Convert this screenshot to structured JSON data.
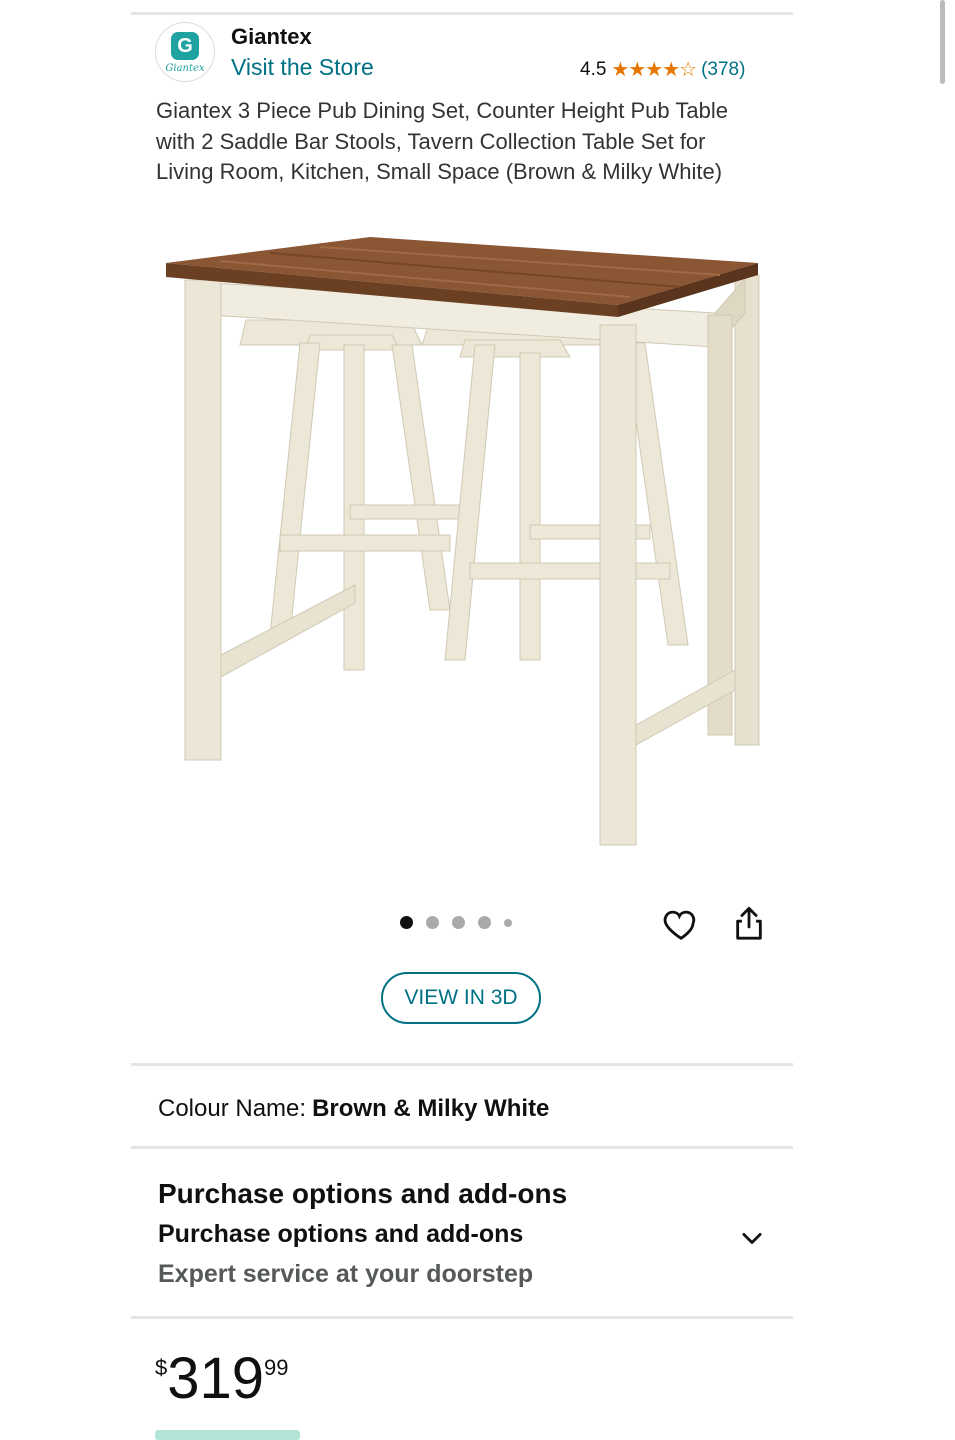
{
  "seller": {
    "logo_letter": "G",
    "logo_word": "Giantex",
    "brand": "Giantex",
    "store_link": "Visit the Store",
    "rating": "4.5",
    "stars": "★★★★☆",
    "review_count": "(378)"
  },
  "product": {
    "title": "Giantex 3 Piece Pub Dining Set, Counter Height Pub Table with 2 Saddle Bar Stools, Tavern Collection Table Set for Living Room, Kitchen, Small Space (Brown & Milky White)",
    "image_alt": "Counter height pub table with two saddle bar stools"
  },
  "gallery": {
    "dots": [
      {
        "active": true,
        "size": "normal"
      },
      {
        "active": false,
        "size": "normal"
      },
      {
        "active": false,
        "size": "normal"
      },
      {
        "active": false,
        "size": "normal"
      },
      {
        "active": false,
        "size": "small"
      }
    ],
    "icons": {
      "wishlist": "heart-icon",
      "share": "share-icon"
    },
    "view3d_label": "VIEW IN 3D"
  },
  "colour": {
    "label": "Colour Name:",
    "value": "Brown & Milky White"
  },
  "purchase_options": {
    "heading": "Purchase options and add-ons",
    "subheading": "Purchase options and add-ons",
    "detail": "Expert service at your doorstep",
    "icon": "chevron-down-icon"
  },
  "price": {
    "symbol": "$",
    "whole": "319",
    "fraction": "99"
  },
  "colors": {
    "link": "#007185",
    "star": "#e77600",
    "divider": "#e3e6e6",
    "wood_top": "#8a5634",
    "cream": "#ebe6d5"
  }
}
